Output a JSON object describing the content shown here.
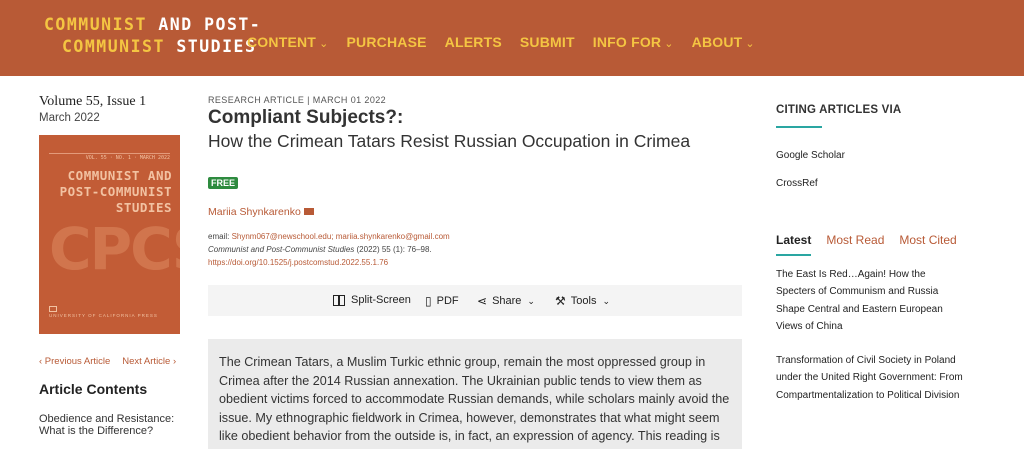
{
  "header": {
    "logo_line1_yellow": "COMMUNIST",
    "logo_line1_white": " AND POST-",
    "logo_line2_yellow": "COMMUNIST ",
    "logo_line2_white": "STUDIES",
    "nav": [
      {
        "label": "CONTENT",
        "has_dropdown": true
      },
      {
        "label": "PURCHASE",
        "has_dropdown": false
      },
      {
        "label": "ALERTS",
        "has_dropdown": false
      },
      {
        "label": "SUBMIT",
        "has_dropdown": false
      },
      {
        "label": "INFO FOR",
        "has_dropdown": true
      },
      {
        "label": "ABOUT",
        "has_dropdown": true
      }
    ],
    "chevron": "⌄"
  },
  "sidebar": {
    "volume": "Volume 55, Issue 1",
    "date": "March 2022",
    "cover": {
      "meta": "VOL. 55 · NO. 1 · MARCH 2022",
      "title_line1": "COMMUNIST AND",
      "title_line2": "POST-COMMUNIST",
      "title_line3": "STUDIES",
      "big": "CPCS",
      "publisher": "UNIVERSITY OF CALIFORNIA PRESS"
    },
    "prev_article": "‹  Previous Article",
    "next_article": "Next Article  ›",
    "contents_heading": "Article Contents",
    "contents_item": "Obedience and Resistance: What is the Difference?"
  },
  "article": {
    "type": "RESEARCH ARTICLE  |  MARCH 01 2022",
    "title": "Compliant Subjects?:",
    "subtitle": " How the Crimean Tatars Resist Russian Occupation in Crimea",
    "badge": "FREE",
    "author": "Mariia Shynkarenko",
    "email_label": "email: ",
    "emails": "Shynm067@newschool.edu; mariia.shynkarenko@gmail.com",
    "journal": "Communist and Post-Communist Studies",
    "citation": " (2022) 55 (1): 76–98.",
    "doi": "https://doi.org/10.1525/j.postcomstud.2022.55.1.76",
    "abstract": "The Crimean Tatars, a Muslim Turkic ethnic group, remain the most oppressed group in Crimea after the 2014 Russian annexation. The Ukrainian public tends to view them as obedient victims forced to accommodate Russian demands, while scholars mainly avoid the issue. My ethnographic fieldwork in Crimea, however, demonstrates that what might seem like obedient behavior from the outside is, in fact, an expression of agency. This reading is based on close-range observations and conversations with people who"
  },
  "toolbar": {
    "split_screen": "Split-Screen",
    "pdf": "PDF",
    "share": "Share",
    "tools": "Tools",
    "chevron": "⌄"
  },
  "right": {
    "citing_heading": "CITING ARTICLES VIA",
    "google_scholar": "Google Scholar",
    "crossref": "CrossRef",
    "tabs": [
      "Latest",
      "Most Read",
      "Most Cited"
    ],
    "latest_items": [
      "The East Is Red…Again! How the Specters of Communism and Russia Shape Central and Eastern European Views of China",
      "Transformation of Civil Society in Poland under the United Right Government: From Compartmentalization to Political Division"
    ]
  },
  "colors": {
    "header_bg": "#b85a36",
    "nav_text": "#f4c542",
    "accent_teal": "#2aa6a2",
    "badge_green": "#2e8b3f",
    "link": "#b85a36"
  }
}
